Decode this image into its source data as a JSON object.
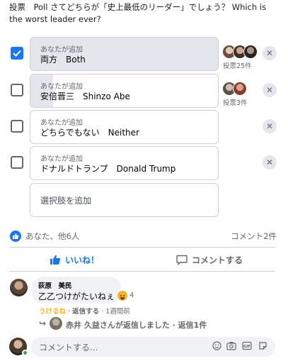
{
  "poll": {
    "question": "投票　Poll さてどちらが「史上最低のリーダー」でしょう？ Which is the worst leader ever?",
    "options": [
      {
        "sub": "あなたが追加",
        "label": "両方　Both",
        "checked": true,
        "fill_fraction": 1.0,
        "votes": "投票25件",
        "voter_avatars": 3
      },
      {
        "sub": "あなたが追加",
        "label": "安倍晋三　Shinzo Abe",
        "checked": false,
        "fill_fraction": 0.12,
        "votes": "投票3件",
        "voter_avatars": 2
      },
      {
        "sub": "あなたが追加",
        "label": "どちらでもない　Neither",
        "checked": false,
        "fill_fraction": 0,
        "votes": "",
        "voter_avatars": 0
      },
      {
        "sub": "あなたが追加",
        "label": "ドナルドトランプ　Donald Trump",
        "checked": false,
        "fill_fraction": 0,
        "votes": "",
        "voter_avatars": 0
      }
    ],
    "add_option_placeholder": "選択肢を追加",
    "remove_glyph": "✕"
  },
  "reactions": {
    "summary": "あなた、他6人",
    "comment_count": "コメント2件"
  },
  "actions": {
    "like_label": "いいね！",
    "comment_label": "コメントする"
  },
  "comment": {
    "author": "荻原　美民",
    "text": "乙乙つけがたいねぇ",
    "reaction_count": "4",
    "meta_liked": "うけるね",
    "meta_reply": "返信する",
    "meta_time": "1週間前",
    "reply_summary": "赤井 久益さんが返信しました · 返信1件"
  },
  "composer": {
    "placeholder": "コメントする..."
  },
  "colors": {
    "accent": "#1877f2",
    "haha": "#f7b125",
    "online": "#31a24c"
  }
}
